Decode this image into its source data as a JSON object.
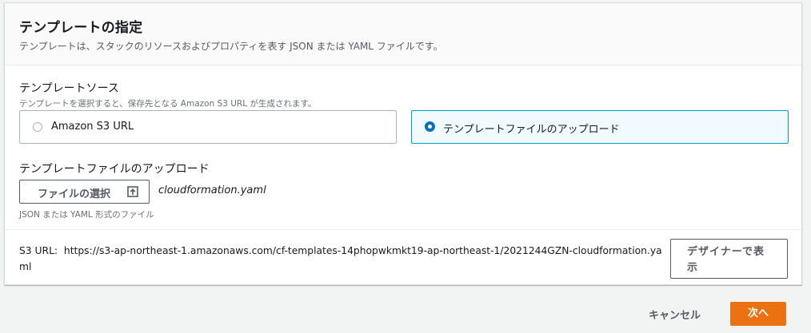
{
  "panel": {
    "title": "テンプレートの指定",
    "description": "テンプレートは、スタックのリソースおよびプロパティを表す JSON または YAML ファイルです。"
  },
  "template_source": {
    "label": "テンプレートソース",
    "hint": "テンプレートを選択すると、保存先となる Amazon S3 URL が生成されます。",
    "options": [
      {
        "label": "Amazon S3 URL",
        "selected": false
      },
      {
        "label": "テンプレートファイルのアップロード",
        "selected": true
      }
    ]
  },
  "upload": {
    "label": "テンプレートファイルのアップロード",
    "button_label": "ファイルの選択",
    "file_name": "cloudformation.yaml",
    "format_hint": "JSON または YAML 形式のファイル"
  },
  "s3": {
    "prefix": "S3 URL:",
    "url": "https://s3-ap-northeast-1.amazonaws.com/cf-templates-14phopwkmkt19-ap-northeast-1/2021244GZN-cloudformation.yaml",
    "designer_button_label": "デザイナーで表示"
  },
  "footer": {
    "cancel_label": "キャンセル",
    "next_label": "次へ"
  },
  "colors": {
    "primary_button": "#ec7211",
    "selected_radio": "#0073bb",
    "selected_tile_bg": "#f1faff",
    "selected_tile_border": "#00a1c9"
  }
}
